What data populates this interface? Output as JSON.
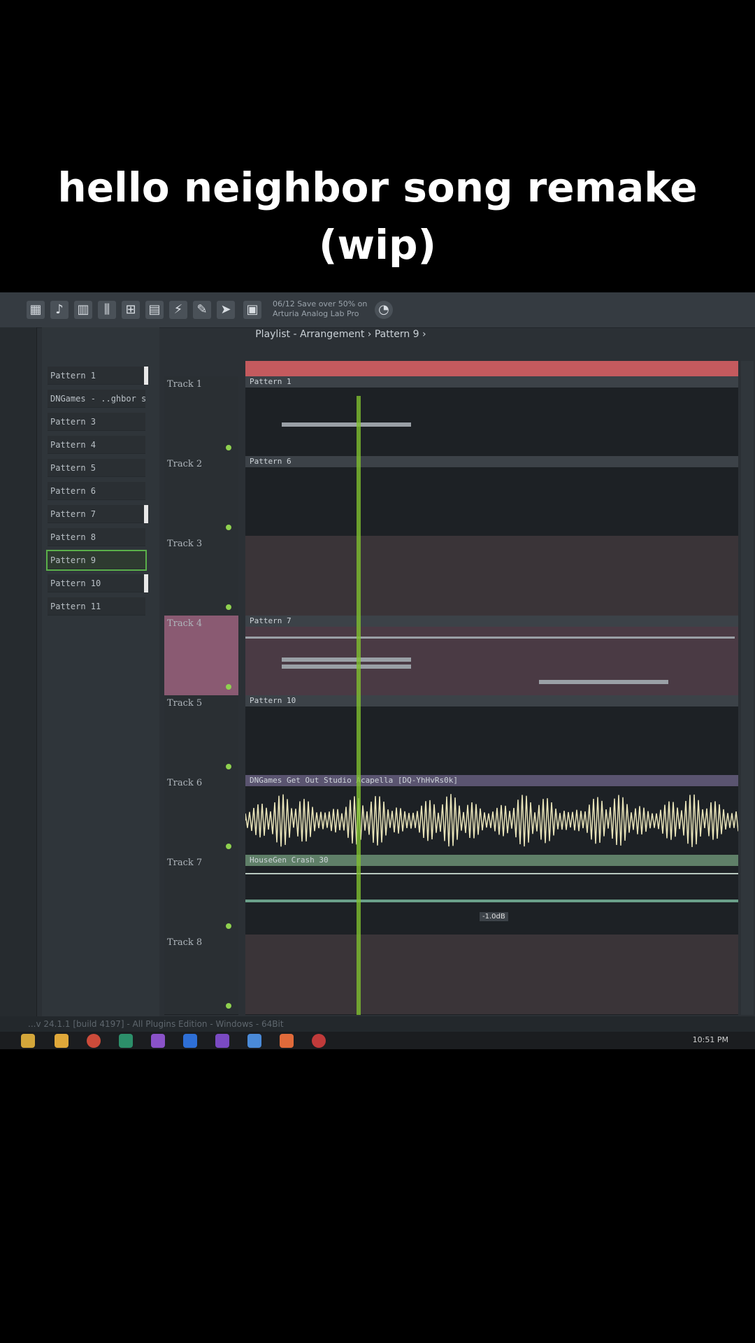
{
  "caption": {
    "line1": "hello neighbor song remake",
    "line2": "(wip)"
  },
  "toolbar": {
    "hint_line1": "06/12 Save over 50% on",
    "hint_line2": "Arturia Analog Lab Pro"
  },
  "playlist": {
    "title": "Playlist - Arrangement › Pattern 9 ›"
  },
  "patterns": [
    "Pattern 1",
    "DNGames - ..ghbor song",
    "Pattern 3",
    "Pattern 4",
    "Pattern 5",
    "Pattern 6",
    "Pattern 7",
    "Pattern 8",
    "Pattern 9",
    "Pattern 10",
    "Pattern 11"
  ],
  "selected_pattern": "Pattern 9",
  "tracks": [
    {
      "name": "Track 1",
      "clip": "Pattern 1"
    },
    {
      "name": "Track 2",
      "clip": "Pattern 6"
    },
    {
      "name": "Track 3",
      "clip": ""
    },
    {
      "name": "Track 4",
      "clip": "Pattern 7"
    },
    {
      "name": "Track 5",
      "clip": "Pattern 10"
    },
    {
      "name": "Track 6",
      "clip": "DNGames Get Out Studio Acapella [DQ-YhHvRs0k]"
    },
    {
      "name": "Track 7",
      "clip": "HouseGen Crash 30"
    },
    {
      "name": "Track 8",
      "clip": ""
    }
  ],
  "volume_readout": "-1.0dB",
  "status": "...v 24.1.1 [build 4197] - All Plugins Edition - Windows - 64Bit",
  "clock": "10:51 PM",
  "colors": {
    "accent": "#7fbf2f",
    "ruler": "#c45a5e",
    "track4": "#8a5a72",
    "track7_clip": "#5f7f68"
  }
}
